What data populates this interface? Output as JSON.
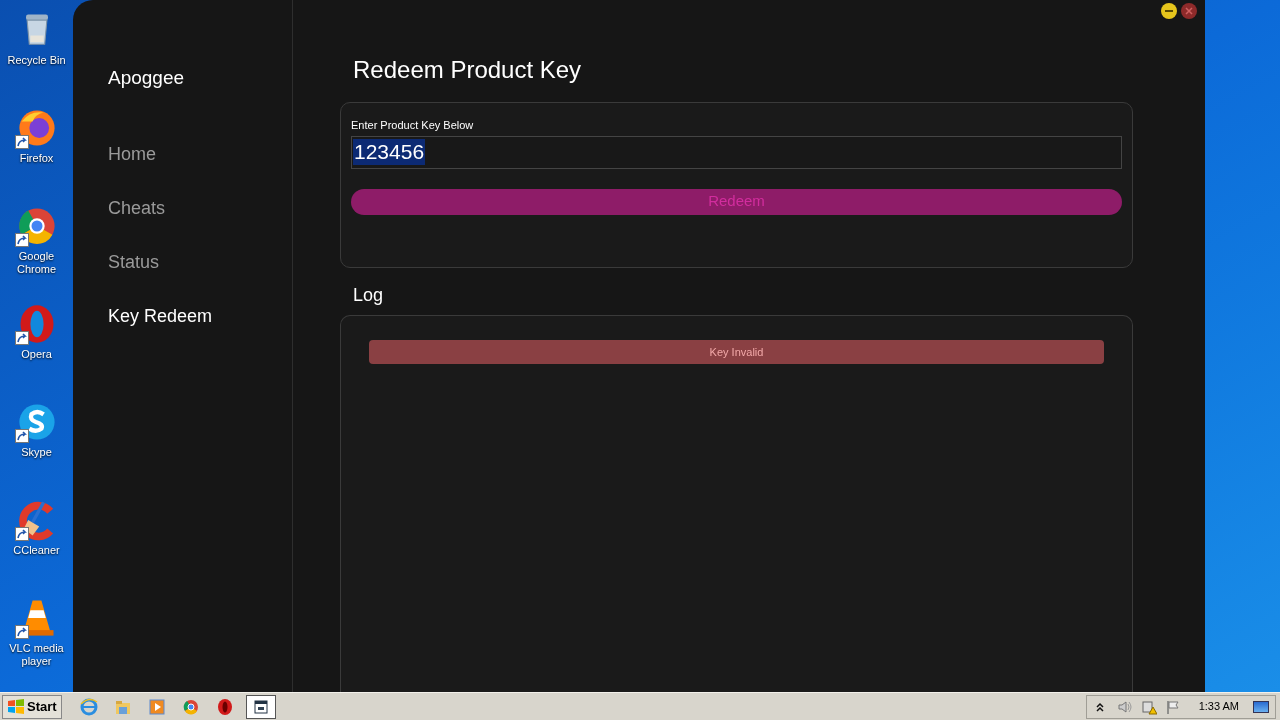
{
  "desktop_icons": [
    {
      "kind": "bin",
      "label": "Recycle Bin",
      "shortcut": false
    },
    {
      "kind": "firefox",
      "label": "Firefox",
      "shortcut": true
    },
    {
      "kind": "chrome",
      "label": "Google Chrome",
      "shortcut": true
    },
    {
      "kind": "opera",
      "label": "Opera",
      "shortcut": true
    },
    {
      "kind": "skype",
      "label": "Skype",
      "shortcut": true
    },
    {
      "kind": "ccleaner",
      "label": "CCleaner",
      "shortcut": true
    },
    {
      "kind": "vlc",
      "label": "VLC media player",
      "shortcut": true
    }
  ],
  "app": {
    "brand": "Apoggee",
    "nav": [
      {
        "label": "Home",
        "selected": false
      },
      {
        "label": "Cheats",
        "selected": false
      },
      {
        "label": "Status",
        "selected": false
      },
      {
        "label": "Key Redeem",
        "selected": true
      }
    ],
    "title": "Redeem Product Key",
    "key_field": {
      "label": "Enter Product Key Below",
      "value": "123456",
      "text_selected": true
    },
    "redeem_button": "Redeem",
    "log_title": "Log",
    "log_entries": [
      {
        "text": "Key Invalid",
        "kind": "error"
      }
    ]
  },
  "taskbar": {
    "start": "Start",
    "apps": [
      {
        "kind": "ie",
        "active": false
      },
      {
        "kind": "explorer",
        "active": false
      },
      {
        "kind": "media",
        "active": false
      },
      {
        "kind": "chrome",
        "active": false
      },
      {
        "kind": "opera",
        "active": false
      },
      {
        "kind": "window",
        "active": true
      }
    ],
    "tray": [
      {
        "kind": "chevron"
      },
      {
        "kind": "speaker"
      },
      {
        "kind": "network"
      },
      {
        "kind": "flag"
      }
    ],
    "clock": "1:33 AM"
  }
}
